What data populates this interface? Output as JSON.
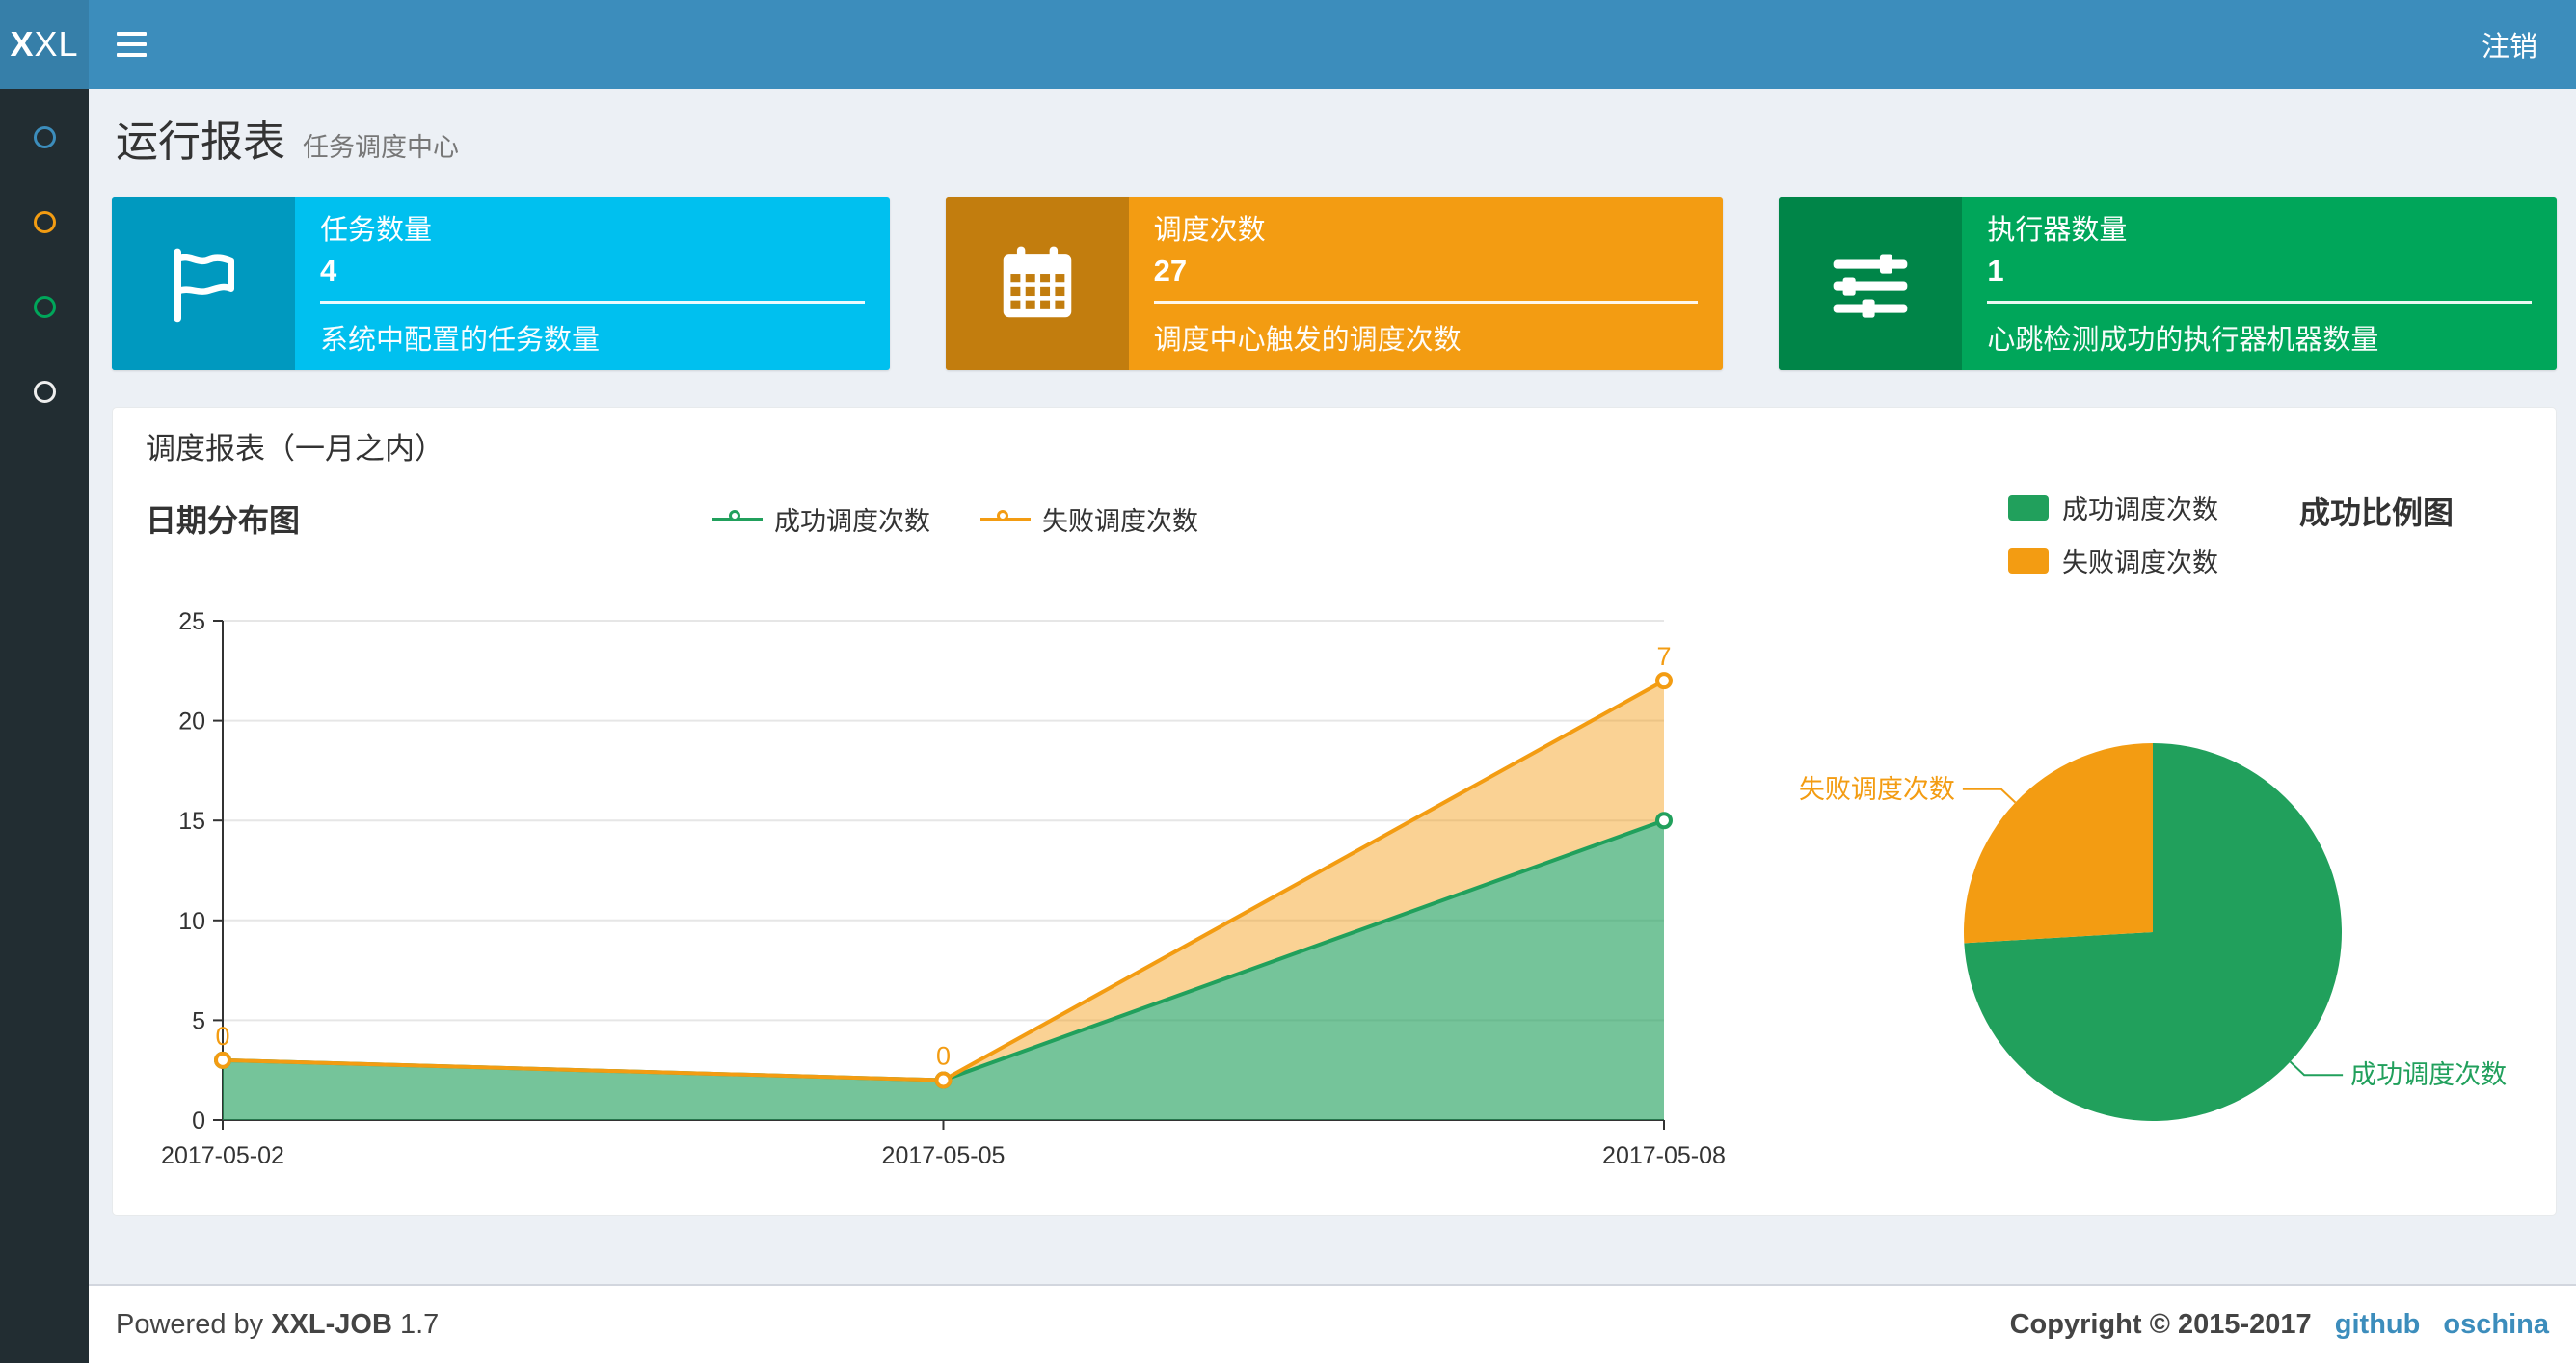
{
  "theme": {
    "header": "#3c8dbc",
    "header_dark": "#367fa9",
    "sidebar": "#222d32",
    "background": "#ecf0f5",
    "link": "#3c8dbc"
  },
  "navbar": {
    "logo_bold": "X",
    "logo_rest": "XL",
    "logout": "注销"
  },
  "sidebar": {
    "items": [
      {
        "color": "#3c8dbc"
      },
      {
        "color": "#f39c12"
      },
      {
        "color": "#00a65a"
      },
      {
        "color": "#eeeeee"
      }
    ]
  },
  "page_header": {
    "title": "运行报表",
    "subtitle": "任务调度中心"
  },
  "info_boxes": [
    {
      "icon": "flag-icon",
      "label": "任务数量",
      "value": "4",
      "desc": "系统中配置的任务数量",
      "bg": "#00c0ef",
      "icon_bg": "#0099bf"
    },
    {
      "icon": "calendar-icon",
      "label": "调度次数",
      "value": "27",
      "desc": "调度中心触发的调度次数",
      "bg": "#f39c12",
      "icon_bg": "#c27d0e"
    },
    {
      "icon": "sliders-icon",
      "label": "执行器数量",
      "value": "1",
      "desc": "心跳检测成功的执行器机器数量",
      "bg": "#00a65a",
      "icon_bg": "#008548"
    }
  ],
  "panel": {
    "title": "调度报表（一月之内）"
  },
  "chart_data": [
    {
      "type": "area",
      "title": "日期分布图",
      "categories": [
        "2017-05-02",
        "2017-05-05",
        "2017-05-08"
      ],
      "stacked": true,
      "series": [
        {
          "name": "成功调度次数",
          "color": "#21a05c",
          "values": [
            3,
            2,
            15
          ]
        },
        {
          "name": "失败调度次数",
          "color": "#f39c12",
          "values": [
            0,
            0,
            7
          ],
          "point_labels": [
            "0",
            "0",
            "7"
          ]
        }
      ],
      "xlabel": "",
      "ylabel": "",
      "ylim": [
        0,
        25
      ],
      "yticks": [
        0,
        5,
        10,
        15,
        20,
        25
      ],
      "grid": true,
      "legend_position": "top-center"
    },
    {
      "type": "pie",
      "title": "成功比例图",
      "slices": [
        {
          "name": "成功调度次数",
          "value": 20,
          "color": "#21a05c"
        },
        {
          "name": "失败调度次数",
          "value": 7,
          "color": "#f39c12"
        }
      ],
      "legend_position": "top-left"
    }
  ],
  "footer": {
    "powered_prefix": "Powered by",
    "brand": "XXL-JOB",
    "version": "1.7",
    "copyright": "Copyright © 2015-2017",
    "links": [
      {
        "label": "github"
      },
      {
        "label": "oschina"
      }
    ]
  }
}
